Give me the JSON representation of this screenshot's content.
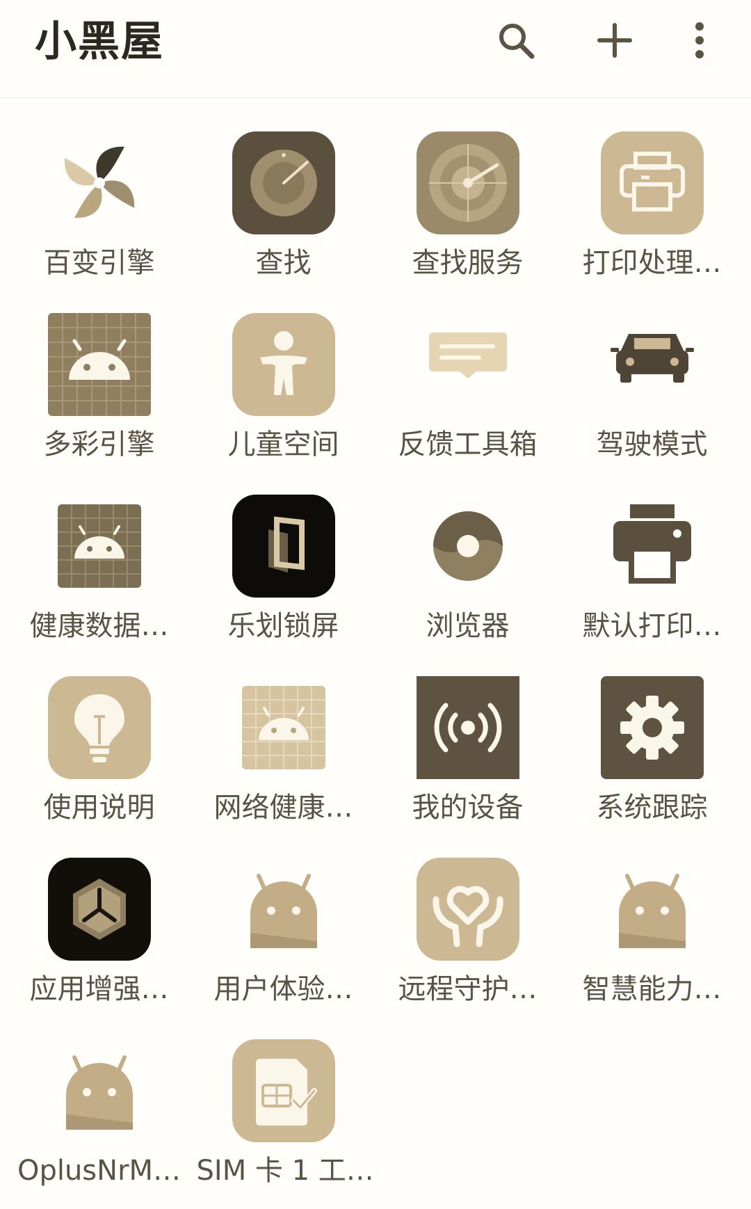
{
  "header": {
    "title": "小黑屋",
    "search_icon": "search-icon",
    "add_icon": "plus-icon",
    "more_icon": "more-vertical-icon"
  },
  "colors": {
    "background": "#fffefb",
    "title": "#2c281f",
    "label": "#5a5244",
    "tile_light": "#cdb894",
    "tile_dark": "#5b4f3e"
  },
  "apps": [
    {
      "label": "百变引擎",
      "icon": "pinwheel-icon"
    },
    {
      "label": "查找",
      "icon": "find-dial-icon"
    },
    {
      "label": "查找服务",
      "icon": "radar-icon"
    },
    {
      "label": "打印处理…",
      "icon": "printer-outline-icon"
    },
    {
      "label": "多彩引擎",
      "icon": "android-grid-icon"
    },
    {
      "label": "儿童空间",
      "icon": "child-figure-icon"
    },
    {
      "label": "反馈工具箱",
      "icon": "feedback-message-icon"
    },
    {
      "label": "驾驶模式",
      "icon": "car-icon"
    },
    {
      "label": "健康数据…",
      "icon": "android-grid-dark-icon"
    },
    {
      "label": "乐划锁屏",
      "icon": "lockscreen-frame-icon"
    },
    {
      "label": "浏览器",
      "icon": "browser-orb-icon"
    },
    {
      "label": "默认打印…",
      "icon": "printer-solid-icon"
    },
    {
      "label": "使用说明",
      "icon": "lightbulb-icon"
    },
    {
      "label": "网络健康…",
      "icon": "android-grid-light-icon"
    },
    {
      "label": "我的设备",
      "icon": "broadcast-icon"
    },
    {
      "label": "系统跟踪",
      "icon": "gear-icon"
    },
    {
      "label": "应用增强…",
      "icon": "hexagon-icon"
    },
    {
      "label": "用户体验…",
      "icon": "android-head-icon"
    },
    {
      "label": "远程守护…",
      "icon": "heart-hands-icon"
    },
    {
      "label": "智慧能力…",
      "icon": "android-head-icon"
    },
    {
      "label": "OplusNrM…",
      "icon": "android-head-icon"
    },
    {
      "label": "SIM 卡 1 工…",
      "icon": "sim-check-icon"
    }
  ]
}
